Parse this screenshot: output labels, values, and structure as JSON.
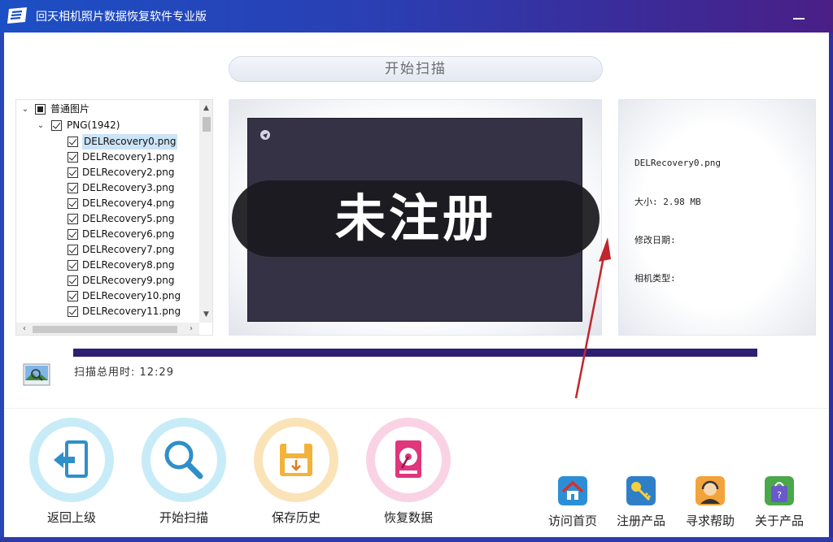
{
  "window": {
    "title": "回天相机照片数据恢复软件专业版"
  },
  "header": {
    "scan_button": "开始扫描"
  },
  "tree": {
    "root_label": "普通图片",
    "group_label": "PNG(1942)",
    "files": [
      "DELRecovery0.png",
      "DELRecovery1.png",
      "DELRecovery2.png",
      "DELRecovery3.png",
      "DELRecovery4.png",
      "DELRecovery5.png",
      "DELRecovery6.png",
      "DELRecovery7.png",
      "DELRecovery8.png",
      "DELRecovery9.png",
      "DELRecovery10.png",
      "DELRecovery11.png"
    ],
    "selected_index": 0
  },
  "preview": {
    "watermark": "未注册"
  },
  "info": {
    "filename": "DELRecovery0.png",
    "size_line": "大小: 2.98 MB",
    "modified_line": "修改日期:",
    "camera_line": "相机类型:"
  },
  "progress": {
    "value_percent": 100,
    "color": "#2f1f73",
    "scan_time_label": "扫描总用时: 12:29"
  },
  "toolbar": {
    "back_label": "返回上级",
    "scan_label": "开始扫描",
    "history_label": "保存历史",
    "recover_label": "恢复数据"
  },
  "links": {
    "home_label": "访问首页",
    "register_label": "注册产品",
    "help_label": "寻求帮助",
    "about_label": "关于产品"
  },
  "colors": {
    "titlebar_start": "#1c4fc4",
    "titlebar_end": "#4a1f86",
    "annotation_arrow": "#c0262c"
  }
}
